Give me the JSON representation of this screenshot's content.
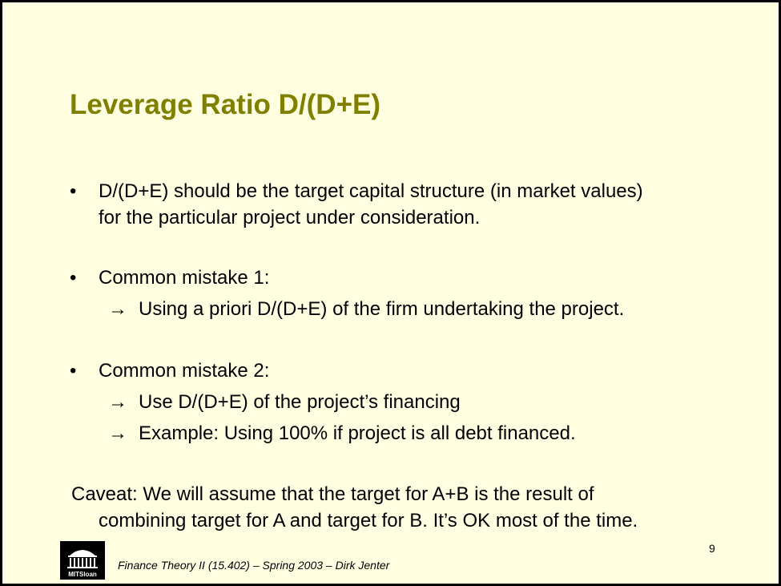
{
  "slide": {
    "title": "Leverage Ratio D/(D+E)",
    "bullets": [
      {
        "bullet": "•",
        "text_line1": "D/(D+E) should be the target capital structure (in market values)",
        "text_line2": "for the particular project under consideration."
      },
      {
        "bullet": "•",
        "text": "Common mistake 1:",
        "subs": [
          {
            "arrow": "→",
            "text": "Using a priori D/(D+E) of the firm undertaking the project."
          }
        ]
      },
      {
        "bullet": "•",
        "text": "Common mistake 2:",
        "subs": [
          {
            "arrow": "→",
            "text": "Use D/(D+E) of the project’s financing"
          },
          {
            "arrow": "→",
            "text": "Example: Using 100% if project is all debt financed."
          }
        ]
      }
    ],
    "caveat_line1": "Caveat: We will assume that the target for A+B is the result of",
    "caveat_line2": "combining target for A and target for B. It’s OK most of the time."
  },
  "footer": {
    "course": "Finance Theory II (15.402) – Spring 2003 – Dirk Jenter",
    "page_number": "9",
    "logo_text": "MITSloan"
  },
  "colors": {
    "background": "#FFFFE1",
    "title": "#808000",
    "border": "#000000"
  }
}
